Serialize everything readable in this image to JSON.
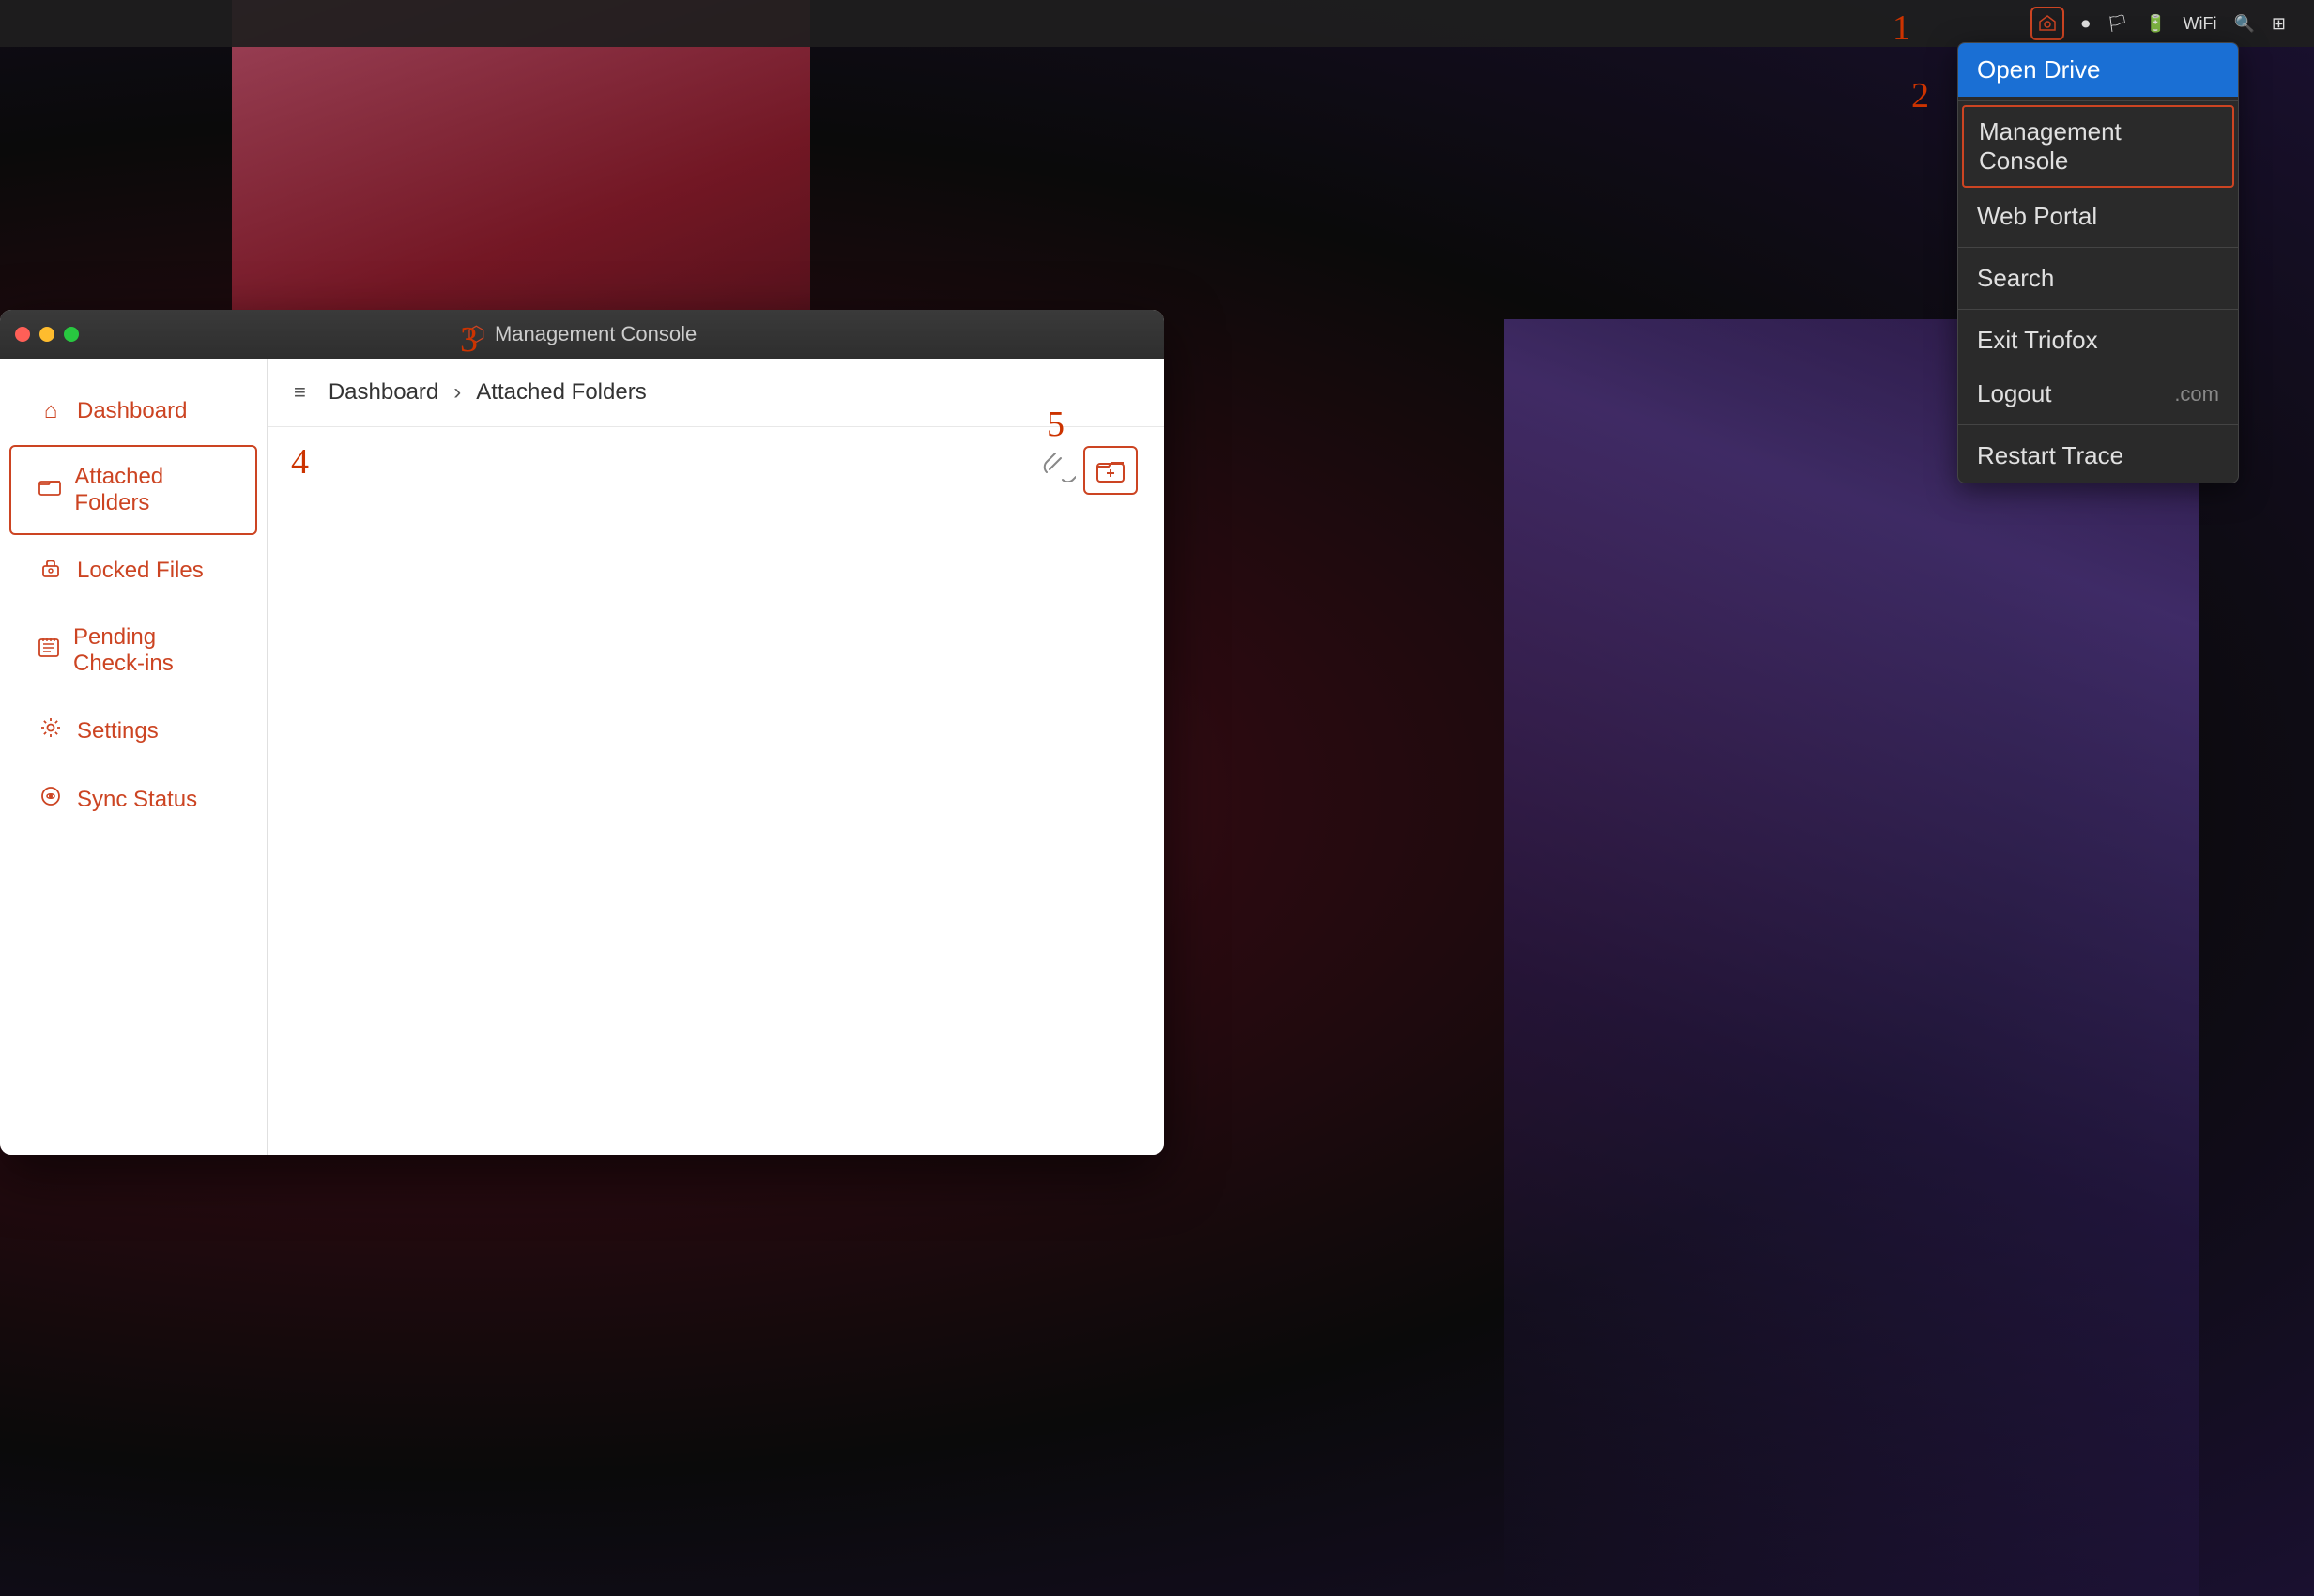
{
  "window": {
    "title": "Management Console",
    "icon": "🛡"
  },
  "menubar": {
    "icons": [
      "triofox",
      "record",
      "flag",
      "battery",
      "wifi",
      "search",
      "control-center"
    ]
  },
  "dropdown": {
    "items": [
      {
        "id": "open-drive",
        "label": "Open Drive",
        "active": true
      },
      {
        "id": "management-console",
        "label": "Management Console",
        "outlined": true
      },
      {
        "id": "web-portal",
        "label": "Web Portal"
      },
      {
        "id": "search",
        "label": "Search"
      },
      {
        "id": "exit-triofox",
        "label": "Exit Triofox"
      },
      {
        "id": "logout",
        "label": "Logout",
        "suffix": ".com"
      },
      {
        "id": "restart-trace",
        "label": "Restart Trace"
      }
    ]
  },
  "sidebar": {
    "items": [
      {
        "id": "dashboard",
        "label": "Dashboard",
        "icon": "⌂"
      },
      {
        "id": "attached-folders",
        "label": "Attached Folders",
        "icon": "▭",
        "active": true
      },
      {
        "id": "locked-files",
        "label": "Locked Files",
        "icon": "🔒"
      },
      {
        "id": "pending-checkins",
        "label": "Pending Check-ins",
        "icon": "📋"
      },
      {
        "id": "settings",
        "label": "Settings",
        "icon": "⚙"
      },
      {
        "id": "sync-status",
        "label": "Sync Status",
        "icon": "🔄"
      }
    ]
  },
  "breadcrumb": {
    "home": "Dashboard",
    "separator": "›",
    "current": "Attached Folders"
  },
  "toolbar": {
    "attach_tooltip": "Attach Folder"
  },
  "annotations": {
    "step1": "1",
    "step2": "2",
    "step3": "3",
    "step4": "4",
    "step5": "5"
  }
}
